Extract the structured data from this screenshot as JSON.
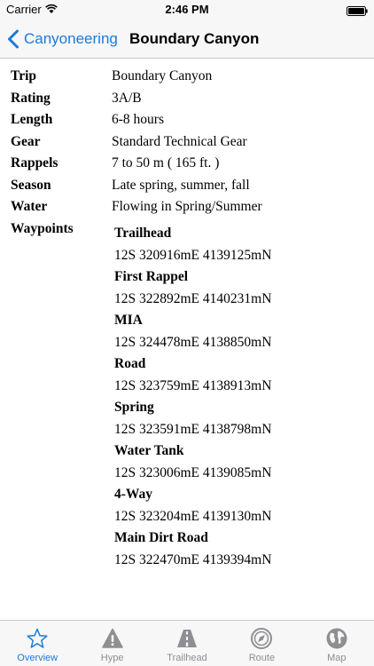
{
  "status_bar": {
    "carrier": "Carrier",
    "time": "2:46 PM"
  },
  "nav": {
    "back_label": "Canyoneering",
    "title": "Boundary Canyon"
  },
  "details": [
    {
      "label": "Trip",
      "value": "Boundary Canyon"
    },
    {
      "label": "Rating",
      "value": "3A/B"
    },
    {
      "label": "Length",
      "value": "6-8 hours"
    },
    {
      "label": "Gear",
      "value": "Standard Technical Gear"
    },
    {
      "label": "Rappels",
      "value": "7 to 50 m ( 165 ft. )"
    },
    {
      "label": "Season",
      "value": "Late spring, summer, fall"
    },
    {
      "label": "Water",
      "value": "Flowing in Spring/Summer"
    }
  ],
  "waypoints": {
    "label": "Waypoints",
    "items": [
      {
        "name": "Trailhead",
        "coord": "12S 320916mE 4139125mN"
      },
      {
        "name": "First Rappel",
        "coord": "12S 322892mE 4140231mN"
      },
      {
        "name": "MIA",
        "coord": "12S 324478mE 4138850mN"
      },
      {
        "name": "Road",
        "coord": "12S 323759mE 4138913mN"
      },
      {
        "name": "Spring",
        "coord": "12S 323591mE 4138798mN"
      },
      {
        "name": "Water Tank",
        "coord": "12S 323006mE 4139085mN"
      },
      {
        "name": "4-Way",
        "coord": "12S 323204mE 4139130mN"
      },
      {
        "name": "Main Dirt Road",
        "coord": "12S 322470mE 4139394mN"
      }
    ]
  },
  "tabs": [
    {
      "label": "Overview",
      "icon": "star-icon",
      "active": true
    },
    {
      "label": "Hype",
      "icon": "warning-icon",
      "active": false
    },
    {
      "label": "Trailhead",
      "icon": "road-icon",
      "active": false
    },
    {
      "label": "Route",
      "icon": "compass-icon",
      "active": false
    },
    {
      "label": "Map",
      "icon": "globe-icon",
      "active": false
    }
  ],
  "colors": {
    "accent": "#1a7ad9",
    "inactive": "#8e8e93"
  }
}
